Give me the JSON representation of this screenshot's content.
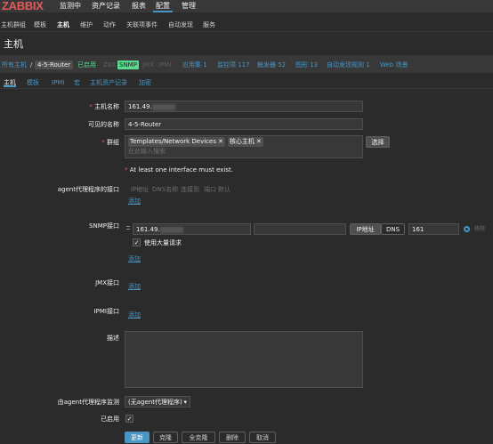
{
  "topnav": {
    "logo": "ZABBIX",
    "items": [
      "监测中",
      "资产记录",
      "报表",
      "配置",
      "管理"
    ],
    "active_index": 3
  },
  "subnav": {
    "items": [
      "主机群组",
      "模板",
      "主机",
      "维护",
      "动作",
      "关联项事件",
      "自动发现",
      "服务"
    ],
    "active_index": 2
  },
  "page_title": "主机",
  "host_header": {
    "all_hosts": "所有主机",
    "separator": "/",
    "host": "4-5-Router",
    "enabled": "已启用",
    "zbx": "ZBX",
    "snmp": "SNMP",
    "jmx": "JMX",
    "ipmi": "IPMI",
    "links": [
      "应用集 1",
      "监控项 117",
      "触发器 52",
      "图形 13",
      "自动发现规则 1",
      "Web 场景"
    ]
  },
  "tabs": [
    "主机",
    "模板",
    "IPMI",
    "宏",
    "主机资产记录",
    "加密"
  ],
  "form": {
    "hostname_label": "主机名称",
    "hostname_value": "161.49.",
    "visible_name_label": "可见的名称",
    "visible_name_value": "4-5-Router",
    "groups_label": "群组",
    "groups": [
      "Templates/Network Devices",
      "核心主机"
    ],
    "groups_placeholder": "在此输入搜索",
    "select_button": "选择",
    "interface_warning": "At least one interface must exist.",
    "agent_label": "agent代理程序的接口",
    "agent_cols": [
      "IP地址",
      "DNS名称",
      "连接到",
      "端口",
      "默认"
    ],
    "add": "添加",
    "snmp_label": "SNMP接口",
    "snmp_ip": "161.49.",
    "snmp_dns": "",
    "ip_toggle": "IP地址",
    "dns_toggle": "DNS",
    "snmp_port": "161",
    "remove": "移除",
    "bulk_label": "使用大量请求",
    "jmx_label": "JMX接口",
    "ipmi_label": "IPMI接口",
    "desc_label": "描述",
    "monitored_by_label": "由agent代理程序监测",
    "monitored_by_value": "(无agent代理程序)",
    "enabled_label": "已启用"
  },
  "footer": {
    "buttons": [
      "更新",
      "克隆",
      "全克隆",
      "删除",
      "取消"
    ]
  },
  "colors": {
    "accent": "#4796c4",
    "enabled": "#59db8f",
    "logo": "#e45959"
  }
}
